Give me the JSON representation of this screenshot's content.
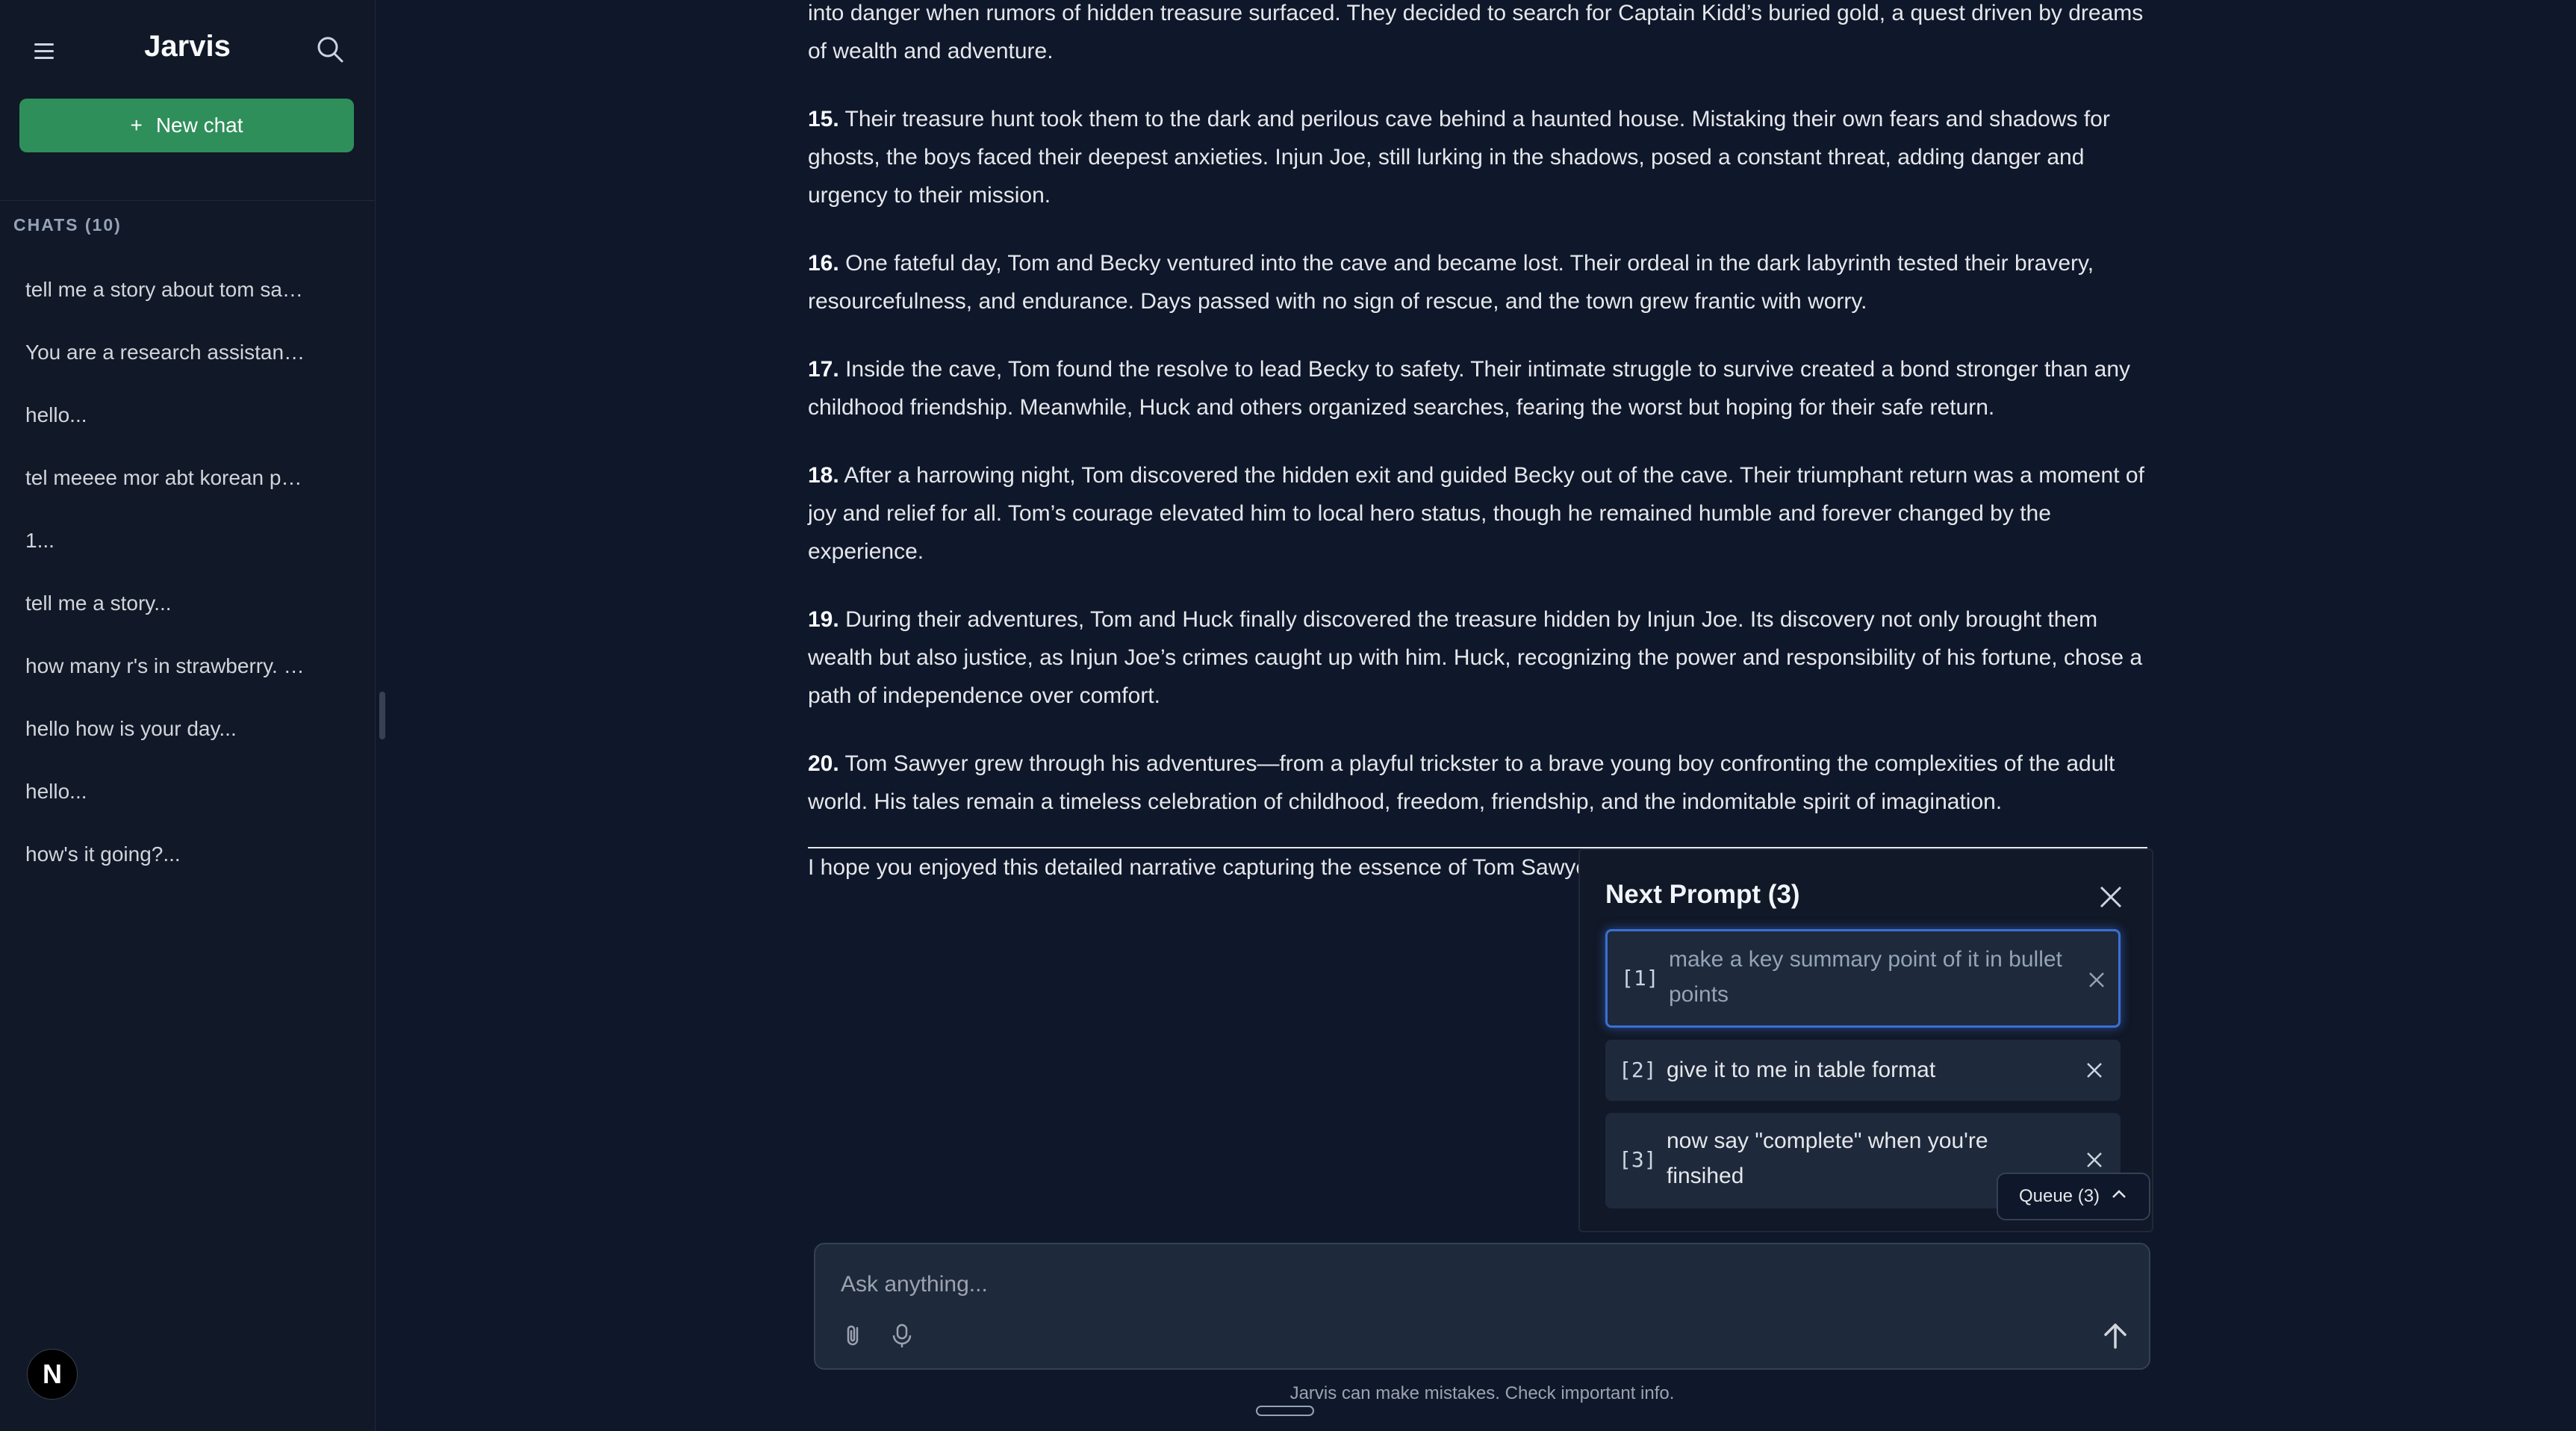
{
  "sidebar": {
    "title": "Jarvis",
    "new_chat_icon": "+",
    "new_chat_label": "New chat",
    "chats_header": "CHATS (10)",
    "chats": [
      "tell me a story about tom sa…",
      "You are a research assistan…",
      "hello...",
      "tel meeee mor abt korean p…",
      "1...",
      "tell me a story...",
      "how many r's in strawberry. …",
      "hello how is your day...",
      "hello...",
      "how's it going?..."
    ],
    "avatar_letter": "N"
  },
  "article": {
    "lead_text": "into danger when rumors of hidden treasure surfaced. They decided to search for Captain Kidd’s buried gold, a quest driven by dreams of wealth and adventure.",
    "items": [
      {
        "num": "15.",
        "text": "Their treasure hunt took them to the dark and perilous cave behind a haunted house. Mistaking their own fears and shadows for ghosts, the boys faced their deepest anxieties. Injun Joe, still lurking in the shadows, posed a constant threat, adding danger and urgency to their mission."
      },
      {
        "num": "16.",
        "text": "One fateful day, Tom and Becky ventured into the cave and became lost. Their ordeal in the dark labyrinth tested their bravery, resourcefulness, and endurance. Days passed with no sign of rescue, and the town grew frantic with worry."
      },
      {
        "num": "17.",
        "text": "Inside the cave, Tom found the resolve to lead Becky to safety. Their intimate struggle to survive created a bond stronger than any childhood friendship. Meanwhile, Huck and others organized searches, fearing the worst but hoping for their safe return."
      },
      {
        "num": "18.",
        "text": "After a harrowing night, Tom discovered the hidden exit and guided Becky out of the cave. Their triumphant return was a moment of joy and relief for all. Tom’s courage elevated him to local hero status, though he remained humble and forever changed by the experience."
      },
      {
        "num": "19.",
        "text": "During their adventures, Tom and Huck finally discovered the treasure hidden by Injun Joe. Its discovery not only brought them wealth but also justice, as Injun Joe’s crimes caught up with him. Huck, recognizing the power and responsibility of his fortune, chose a path of independence over comfort."
      },
      {
        "num": "20.",
        "text": "Tom Sawyer grew through his adventures—from a playful trickster to a brave young boy confronting the complexities of the adult world. His tales remain a timeless celebration of childhood, freedom, friendship, and the indomitable spirit of imagination."
      }
    ],
    "closing": "I hope you enjoyed this detailed narrative capturing the essence of Tom Sawye on any particular event or character."
  },
  "queue_panel": {
    "title": "Next Prompt (3)",
    "items": [
      {
        "index": "[1]",
        "text": "make a key summary point of it in bullet points"
      },
      {
        "index": "[2]",
        "text": "give it to me in table format"
      },
      {
        "index": "[3]",
        "text": "now say \"complete\" when you're finsihed"
      }
    ],
    "toggle_label": "Queue (3)"
  },
  "composer": {
    "placeholder": "Ask anything...",
    "disclaimer": "Jarvis can make mistakes. Check important info."
  },
  "icons": {
    "menu": "hamburger-icon",
    "search": "search-icon",
    "close": "close-icon",
    "attach": "paperclip-icon",
    "mic": "microphone-icon",
    "send": "arrow-up-icon",
    "chevron": "chevron-up-icon"
  },
  "colors": {
    "background": "#0f172a",
    "sidebar": "#111827",
    "accent_green": "#2f8f5b",
    "active_border": "#3b6fd4"
  }
}
